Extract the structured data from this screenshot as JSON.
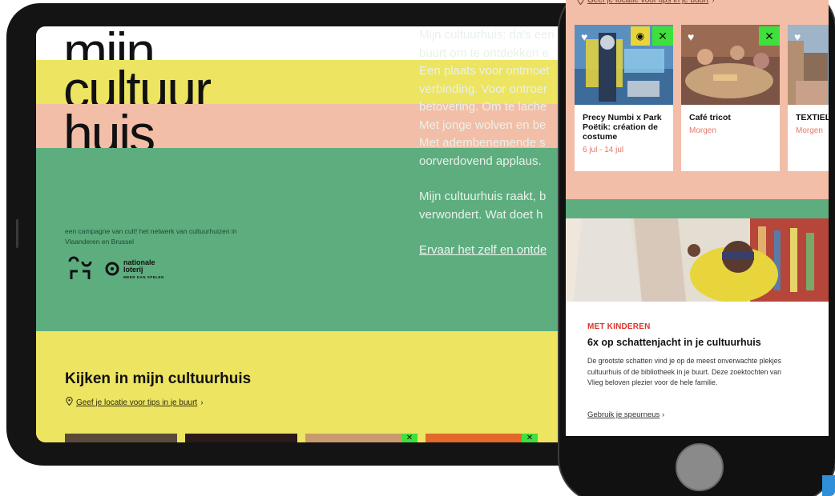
{
  "tablet": {
    "logo": {
      "line1": "mijn",
      "line2": "cultuur",
      "line3": "huis"
    },
    "intro": {
      "lines": [
        "Mijn cultuurhuis: da's een",
        "buurt om te ontdekken e",
        "Een plaats voor ontmoet",
        "verbinding. Voor ontroer",
        "betovering. Om te lache",
        "Met jonge wolven en be",
        "Met adembenemende s",
        "oorverdovend applaus."
      ],
      "line_b": "Mijn cultuurhuis raakt, b",
      "line_c": "verwondert. Wat doet h",
      "cta": "Ervaar het zelf en ontde"
    },
    "campaign_text": "een campagne van cult! het netwerk van cultuurhuizen in Vlaanderen en Brussel",
    "sponsor": {
      "line1": "nationale",
      "line2": "loterij",
      "line3": "MEER DAN SPELEN"
    },
    "section_title": "Kijken in mijn cultuurhuis",
    "location_link": "Geef je locatie voor tips in je buurt",
    "colors": {
      "yellow": "#ede461",
      "pink": "#f2bea8",
      "green": "#5dad7f"
    }
  },
  "phone": {
    "location_link": "Geef je locatie voor tips in je buurt",
    "cards": [
      {
        "title": "Precy Numbi x Park Poëtik: création de costume",
        "date": "6 jul - 14 jul"
      },
      {
        "title": "Café tricot",
        "date": "Morgen"
      },
      {
        "title": "TEXTIEL AY x disc",
        "date": "Morgen"
      }
    ],
    "article": {
      "kicker": "MET KINDEREN",
      "headline": "6x op schattenjacht in je cultuurhuis",
      "body_lines": [
        "De grootste schatten vind je op de meest onverwachte plekjes",
        "cultuurhuis of de bibliotheek in je buurt. Deze zoektochten van",
        "Vlieg beloven plezier voor de hele familie."
      ],
      "more_link": "Gebruik je speurneus"
    }
  }
}
